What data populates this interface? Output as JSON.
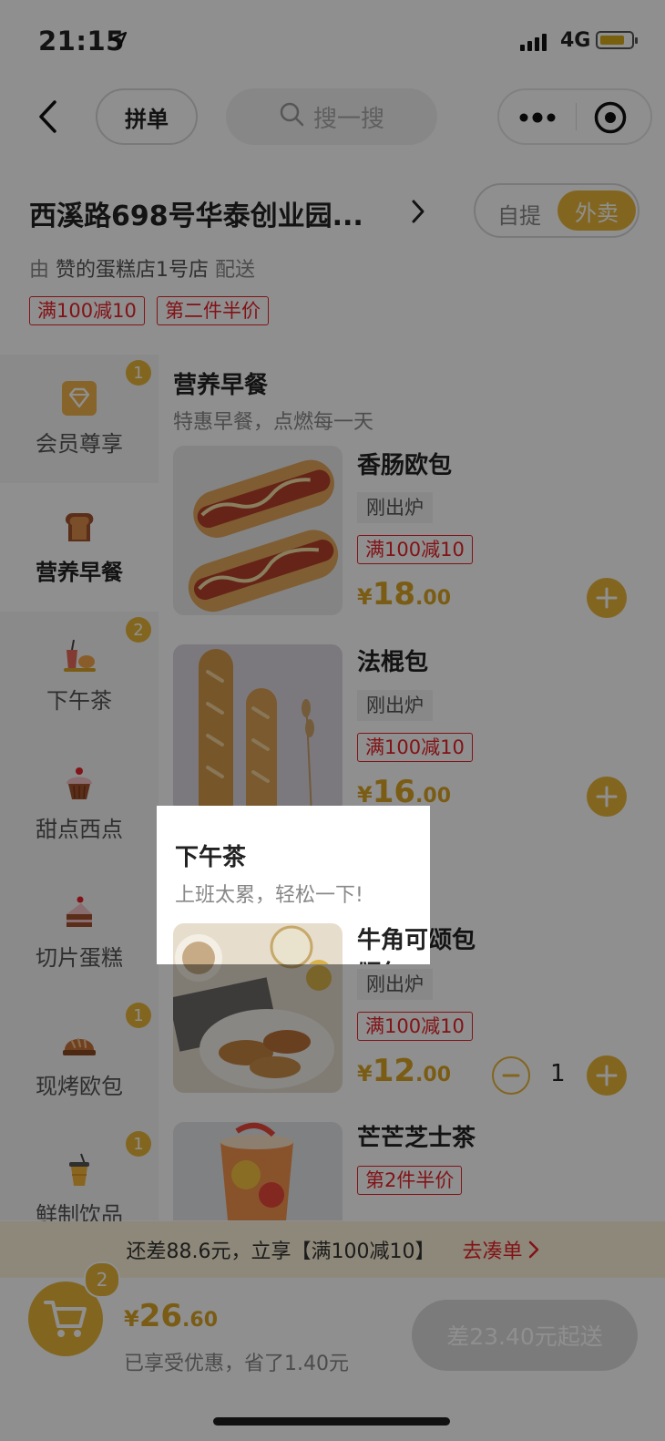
{
  "status_bar": {
    "time": "21:15",
    "network": "4G"
  },
  "nav": {
    "pin_label": "拼单",
    "search_placeholder": "搜一搜"
  },
  "store": {
    "address": "西溪路698号华泰创业园...",
    "mode_options": [
      "自提",
      "外卖"
    ],
    "active_mode": "外卖",
    "delivery_prefix": "由",
    "shop_name": "赞的蛋糕店1号店",
    "delivery_suffix": "配送",
    "promo_tags": [
      "满100减10",
      "第二件半价"
    ]
  },
  "sidebar": {
    "categories": [
      {
        "label": "会员尊享",
        "badge": "1",
        "icon": "diamond-icon"
      },
      {
        "label": "营养早餐",
        "badge": "",
        "icon": "toast-icon",
        "active": true
      },
      {
        "label": "下午茶",
        "badge": "2",
        "icon": "tea-icon"
      },
      {
        "label": "甜点西点",
        "badge": "",
        "icon": "cupcake-icon"
      },
      {
        "label": "切片蛋糕",
        "badge": "",
        "icon": "cake-slice-icon"
      },
      {
        "label": "现烤欧包",
        "badge": "1",
        "icon": "bread-icon"
      },
      {
        "label": "鲜制饮品",
        "badge": "1",
        "icon": "drink-icon"
      }
    ]
  },
  "sections": {
    "breakfast": {
      "title": "营养早餐",
      "subtitle": "特惠早餐，点燃每一天"
    },
    "tea": {
      "title": "下午茶",
      "subtitle": "上班太累，轻松一下!"
    }
  },
  "products": [
    {
      "name": "香肠欧包",
      "fresh": "刚出炉",
      "tag": "满100减10",
      "currency": "¥",
      "price_int": "18",
      "price_dec": ".00"
    },
    {
      "name": "法棍包",
      "fresh": "刚出炉",
      "tag": "满100减10",
      "currency": "¥",
      "price_int": "16",
      "price_dec": ".00"
    },
    {
      "name": "牛角可颂包",
      "fresh": "刚出炉",
      "tag": "满100减10",
      "currency": "¥",
      "price_int": "12",
      "price_dec": ".00",
      "quantity": "1"
    },
    {
      "name": "芒芒芝士茶",
      "tag": "第2件半价"
    }
  ],
  "cart": {
    "hint": "还差88.6元，立享【满100减10】",
    "hint_action": "去凑单",
    "count": "2",
    "currency": "¥",
    "total_int": "26",
    "total_dec": ".60",
    "saved": "已享受优惠，省了1.40元",
    "checkout_label": "差23.40元起送"
  },
  "colors": {
    "accent": "#e8b63a",
    "promo_red": "#e8232a",
    "overlay": "rgba(0,0,0,0.44)"
  }
}
